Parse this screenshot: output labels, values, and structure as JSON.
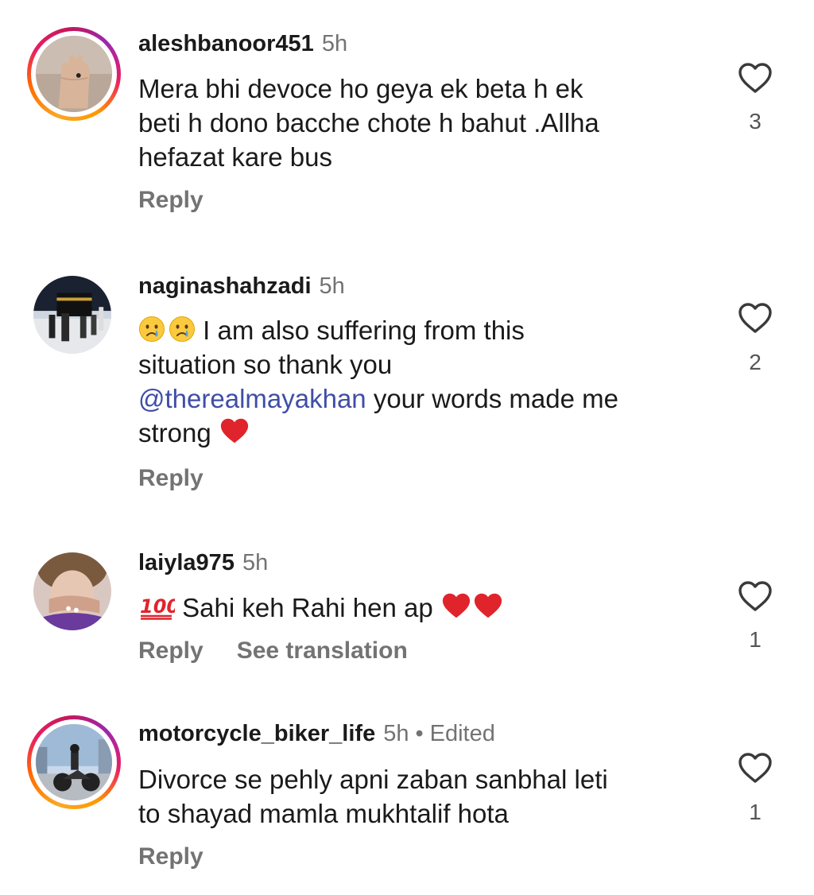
{
  "comments": [
    {
      "username": "aleshbanoor451",
      "time": "5h",
      "lines": [
        "Mera bhi devoce ho geya ek beta h ek",
        "beti h dono bacche chote h bahut .Allha",
        "hefazat kare bus"
      ],
      "reply": "Reply",
      "likes": "3"
    },
    {
      "username": "naginashahzadi",
      "time": "5h",
      "text_a": "I am also suffering from this",
      "text_b": "situation so thank you",
      "mention": "@therealmayakhan",
      "text_c": " your words made me",
      "text_d": "strong",
      "reply": "Reply",
      "likes": "2"
    },
    {
      "username": "laiyla975",
      "time": "5h",
      "text": "Sahi keh Rahi hen ap",
      "reply": "Reply",
      "translate": "See translation",
      "likes": "1"
    },
    {
      "username": "motorcycle_biker_life",
      "time": "5h",
      "separator": "•",
      "edited": "Edited",
      "lines": [
        "Divorce se pehly apni zaban sanbhal leti",
        "to shayad mamla mukhtalif hota"
      ],
      "reply": "Reply",
      "likes": "1"
    }
  ],
  "colors": {
    "text": "#1a1a1a",
    "muted": "#737373",
    "mention": "#3f4ea6",
    "heart_emoji": "#e0242c"
  },
  "icons": [
    "heart-outline-icon",
    "crying-face-emoji",
    "hundred-points-emoji",
    "red-heart-emoji"
  ]
}
